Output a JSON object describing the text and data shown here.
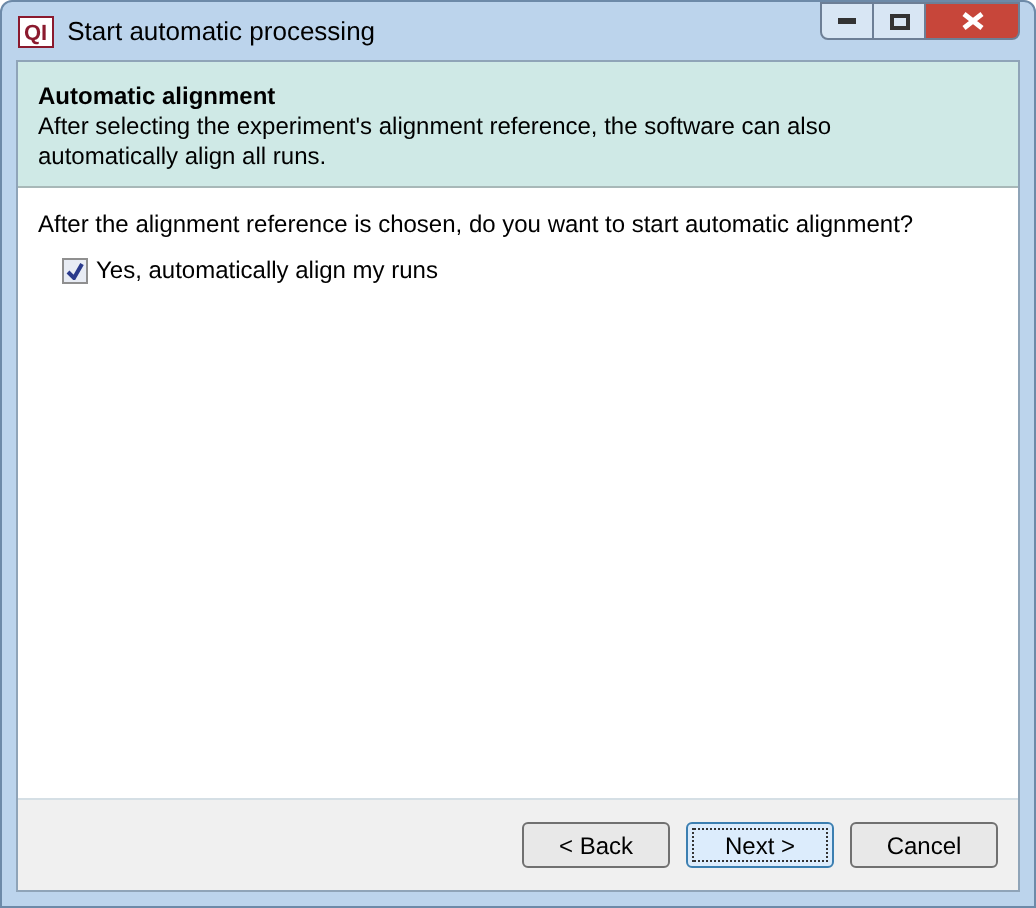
{
  "window": {
    "title": "Start automatic processing",
    "logo": "QI"
  },
  "header": {
    "title": "Automatic alignment",
    "description": "After selecting the experiment's alignment reference, the software can also automatically align all runs."
  },
  "question": "After the alignment reference is chosen, do you want to start automatic alignment?",
  "checkbox": {
    "label": "Yes, automatically align my runs",
    "checked": true
  },
  "buttons": [
    {
      "label": "< Back",
      "focused": false
    },
    {
      "label": "Next >",
      "focused": true
    },
    {
      "label": "Cancel",
      "focused": false
    }
  ]
}
